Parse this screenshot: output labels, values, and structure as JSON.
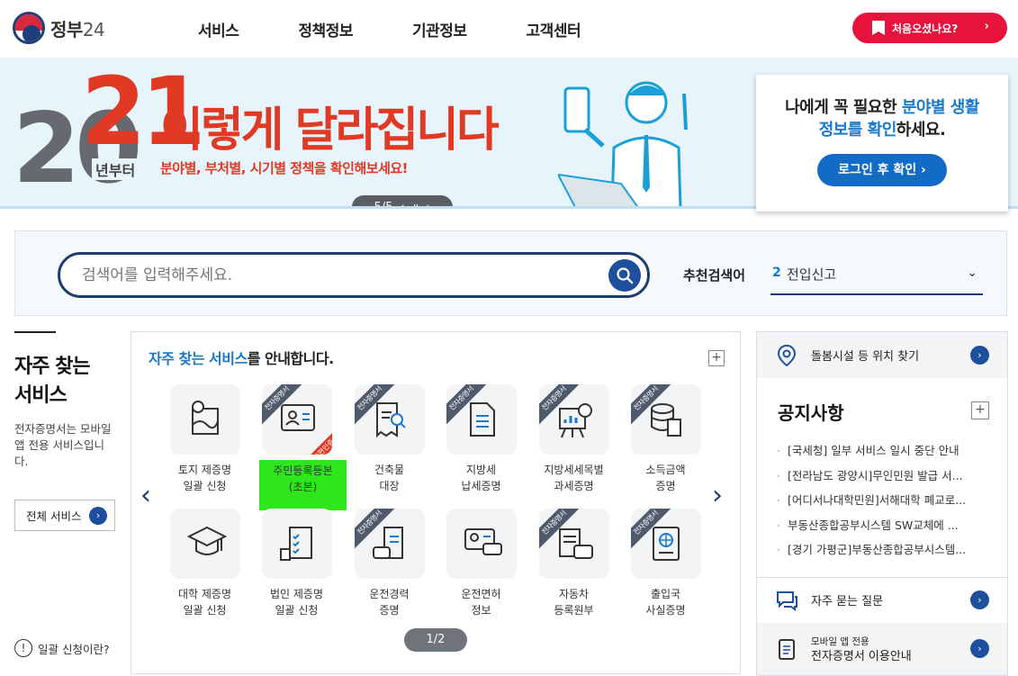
{
  "header": {
    "logo_text": "정부",
    "logo_num": "24",
    "nav": [
      "서비스",
      "정책정보",
      "기관정보",
      "고객센터"
    ],
    "first_visit_button": "처음오셨나요?"
  },
  "banner": {
    "year_prefix": "20",
    "year_suffix": "21",
    "since": "년부터",
    "headline": "이렇게 달라집니다",
    "subline": "분야별, 부처별, 시기별 정책을 확인해보세요!",
    "pager": "5/5",
    "login_msg_1": "나에게 꼭 필요한 ",
    "login_msg_hl1": "분야별 생활",
    "login_msg_hl2": "정보를 확인",
    "login_msg_2": "하세요.",
    "login_button": "로그인 후 확인 ›"
  },
  "search": {
    "placeholder": "검색어를 입력해주세요.",
    "recommend_label": "추천검색어",
    "recommend_rank": "2",
    "recommend_word": "전입신고"
  },
  "left": {
    "title_1": "자주 찾는",
    "title_2": "서비스",
    "desc": "전자증명서는 모바일 앱 전용 서비스입니다.",
    "all_services": "전체 서비스",
    "bulk_link": "일괄 신청이란?"
  },
  "services": {
    "title_hl": "자주 찾는 서비스",
    "title_rest": "를 안내합니다.",
    "ribbon_text": "전자증명서",
    "simple_auth_text": "간편인증",
    "pager": "1/2",
    "items": [
      {
        "line1": "토지 제증명",
        "line2": "일괄 신청",
        "icon": "map-icon",
        "ribbon": false
      },
      {
        "line1": "주민등록등본",
        "line2": "(초본)",
        "icon": "id-card-icon",
        "ribbon": true
      },
      {
        "line1": "건축물",
        "line2": "대장",
        "icon": "document-search-icon",
        "ribbon": true
      },
      {
        "line1": "지방세",
        "line2": "납세증명",
        "icon": "document-icon",
        "ribbon": true
      },
      {
        "line1": "지방세세목별",
        "line2": "과세증명",
        "icon": "chart-board-icon",
        "ribbon": true
      },
      {
        "line1": "소득금액",
        "line2": "증명",
        "icon": "coins-icon",
        "ribbon": true
      },
      {
        "line1": "대학 제증명",
        "line2": "일괄 신청",
        "icon": "graduation-cap-icon",
        "ribbon": false
      },
      {
        "line1": "법인 제증명",
        "line2": "일괄 신청",
        "icon": "checklist-stamp-icon",
        "ribbon": false
      },
      {
        "line1": "운전경력",
        "line2": "증명",
        "icon": "car-document-icon",
        "ribbon": true
      },
      {
        "line1": "운전면허",
        "line2": "정보",
        "icon": "license-car-icon",
        "ribbon": false
      },
      {
        "line1": "자동차",
        "line2": "등록원부",
        "icon": "car-register-icon",
        "ribbon": true
      },
      {
        "line1": "출입국",
        "line2": "사실증명",
        "icon": "passport-icon",
        "ribbon": true
      }
    ]
  },
  "right": {
    "care_facility": "돌봄시설 등 위치 찾기",
    "notice_title": "공지사항",
    "notices": [
      "[국세청] 일부 서비스 일시 중단 안내",
      "[전라남도 광양시]무인민원 발급 서...",
      "[어디서나대학민원]서해대학 폐교로...",
      "부동산종합공부시스템 SW교체에 ...",
      "[경기 가평군]부동산종합공부시스템..."
    ],
    "faq": "자주 묻는 질문",
    "mobile_1": "모바일 앱 전용",
    "mobile_2": "전자증명서 이용안내"
  },
  "colors": {
    "accent_red": "#e6143c",
    "navy": "#1d3d6e",
    "link_blue": "#1979cc",
    "highlight_green": "#2ee61b"
  }
}
